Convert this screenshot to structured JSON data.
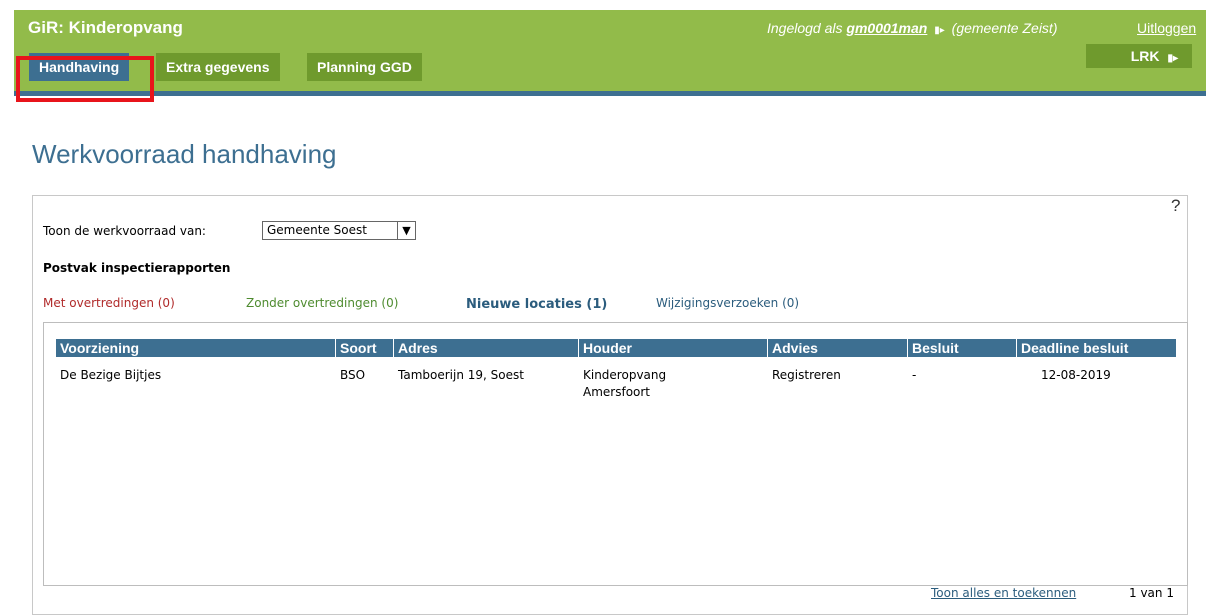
{
  "header": {
    "app_title": "GiR: Kinderopvang",
    "login_prefix": "Ingelogd als",
    "username": "gm0001man",
    "municipality": "(gemeente Zeist)",
    "logout": "Uitloggen",
    "lrk": "LRK"
  },
  "tabs": [
    {
      "label": "Handhaving",
      "active": true
    },
    {
      "label": "Extra gegevens",
      "active": false
    },
    {
      "label": "Planning GGD",
      "active": false
    }
  ],
  "page": {
    "title": "Werkvoorraad handhaving",
    "help": "?"
  },
  "filter": {
    "label": "Toon de werkvoorraad van:",
    "selected": "Gemeente Soest"
  },
  "inbox": {
    "label": "Postvak inspectierapporten",
    "subtabs": [
      {
        "label": "Met overtredingen (0)"
      },
      {
        "label": "Zonder overtredingen (0)"
      },
      {
        "label": "Nieuwe locaties (1)"
      },
      {
        "label": "Wijzigingsverzoeken (0)"
      }
    ]
  },
  "table": {
    "headers": [
      "Voorziening",
      "Soort",
      "Adres",
      "Houder",
      "Advies",
      "Besluit",
      "Deadline besluit"
    ],
    "rows": [
      {
        "voorziening": "De Bezige Bijtjes",
        "soort": "BSO",
        "adres": "Tamboerijn 19, Soest",
        "houder_line1": "Kinderopvang",
        "houder_line2": "Amersfoort",
        "advies": "Registreren",
        "besluit": "-",
        "deadline": "12-08-2019"
      }
    ]
  },
  "footer": {
    "link": "Toon alles en toekennen",
    "pager": "1 van 1"
  },
  "colors": {
    "header_green": "#92bb4a",
    "tab_green": "#6f9a2d",
    "tab_active_blue": "#3d6f91",
    "highlight_red": "#e8141b"
  }
}
